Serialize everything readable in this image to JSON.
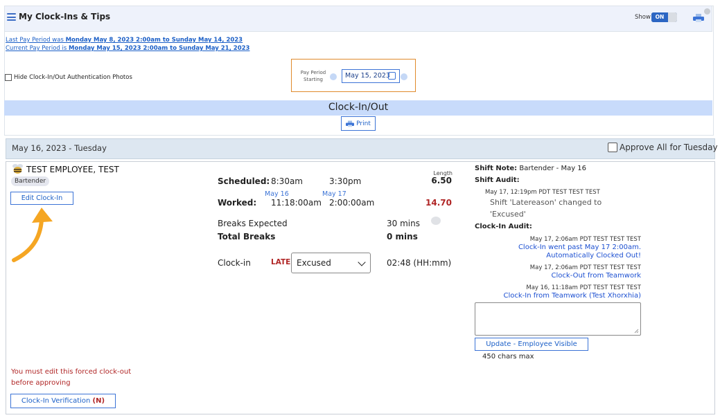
{
  "header": {
    "title": "My Clock-Ins & Tips",
    "show_label": "Show",
    "toggle_state": "ON",
    "menu_icon": "hamburger-icon",
    "print_icon": "printer-icon",
    "settings_icon": "gear-icon"
  },
  "pay_periods": {
    "last_prefix": "Last Pay Period was ",
    "last_range": "Monday May 8, 2023 2:00am to Sunday May 14, 2023",
    "current_prefix": "Current Pay Period is ",
    "current_range": "Monday May 15, 2023 2:00am to Sunday May 21, 2023"
  },
  "hide_photos_label": "Hide Clock-In/Out Authentication Photos",
  "period_selector": {
    "label_line1": "Pay Period",
    "label_line2": "Starting",
    "date_value": "May 15, 2023",
    "calendar_icon": "calendar-icon"
  },
  "section": {
    "title": "Clock-In/Out",
    "print_label": "Print"
  },
  "day": {
    "title": "May 16, 2023 - Tuesday",
    "approve_all_label": "Approve All for Tuesday"
  },
  "employee": {
    "name": "TEST EMPLOYEE, TEST",
    "role": "Bartender",
    "edit_button": "Edit Clock-In",
    "forced_message": "You must edit this forced clock-out before approving",
    "verification_label": "Clock-In Verification",
    "verification_flag": "(N)"
  },
  "shift": {
    "scheduled_label": "Scheduled:",
    "scheduled_start": "8:30am",
    "scheduled_end": "3:30pm",
    "length_label": "Length",
    "length_value": "6.50",
    "worked_label": "Worked:",
    "worked_start_date": "May 16",
    "worked_start": "11:18:00am",
    "worked_end_date": "May 17",
    "worked_end": "2:00:00am",
    "worked_total": "14.70",
    "breaks_expected_label": "Breaks Expected",
    "breaks_expected_value": "30 mins",
    "total_breaks_label": "Total Breaks",
    "total_breaks_value": "0 mins",
    "clockin_label": "Clock-in",
    "late_label": "LATE",
    "status_selected": "Excused",
    "late_duration": "02:48 (HH:mm)"
  },
  "audit": {
    "shift_note_label": "Shift Note:",
    "shift_note_value": "Bartender - May 16",
    "shift_audit_label": "Shift Audit:",
    "shift_audit_meta": "May 17, 12:19pm PDT TEST TEST TEST",
    "shift_audit_text1": "Shift 'Latereason' changed to",
    "shift_audit_text2": "'Excused'",
    "clockin_audit_label": "Clock-In Audit:",
    "entries": [
      {
        "meta": "May 17, 2:06am PDT TEST TEST TEST",
        "line1": "Clock-In went past May 17 2:00am.",
        "line2": "Automatically Clocked Out!"
      },
      {
        "meta": "May 17, 2:06am PDT TEST TEST TEST",
        "line1": "Clock-Out from Teamwork"
      },
      {
        "meta": "May 16, 11:18am PDT TEST TEST TEST",
        "line1": "Clock-In from Teamwork (Test Xhorxhia)"
      }
    ],
    "note_placeholder": "",
    "update_button": "Update - Employee Visible",
    "chars_max": "450 chars max"
  },
  "colors": {
    "accent_blue": "#3b73d6",
    "section_bar": "#c8dbfb",
    "late_red": "#b02626",
    "highlight_orange": "#e08a2b",
    "arrow_orange": "#f5a623"
  }
}
